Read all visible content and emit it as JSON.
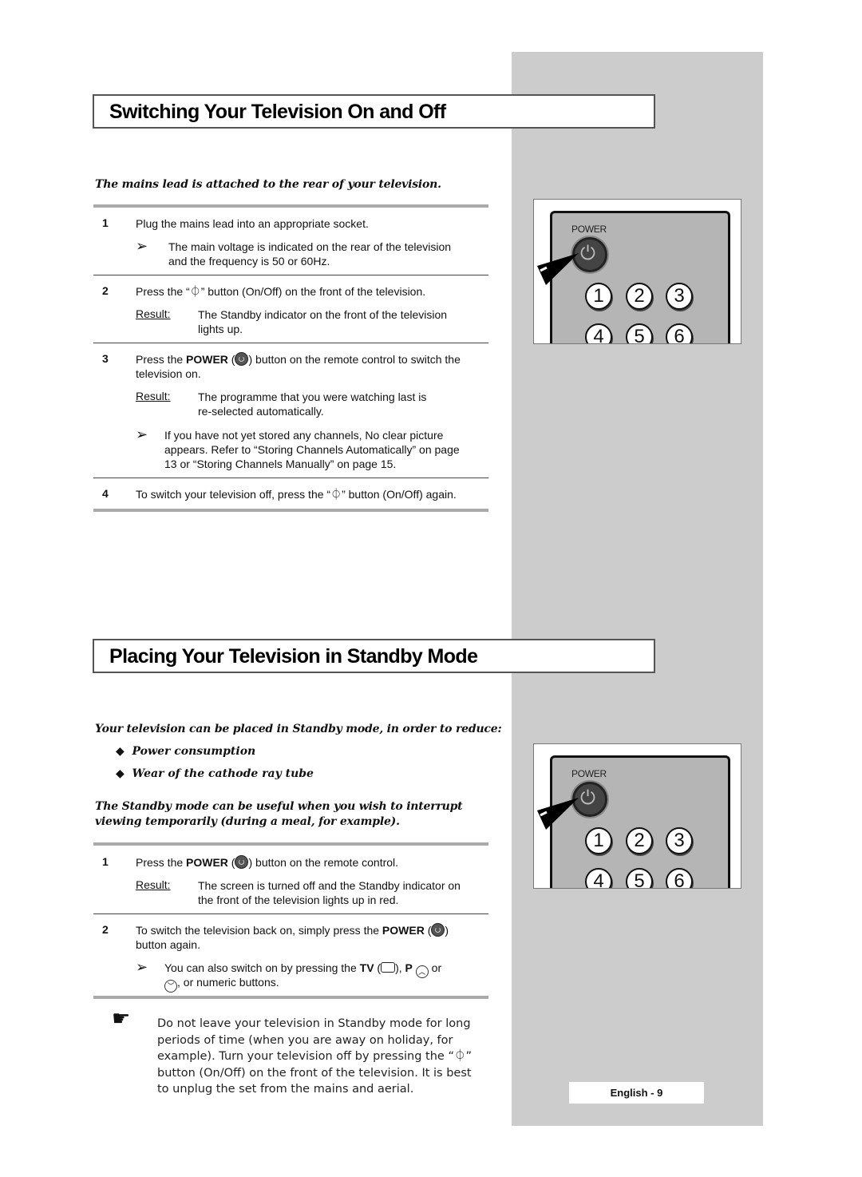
{
  "page": {
    "footer_label": "English - 9"
  },
  "section1": {
    "title": "Switching Your Television On and Off",
    "intro": "The mains lead is attached to the rear of your television.",
    "steps": [
      {
        "num": "1",
        "text": "Plug the mains lead into an appropriate socket.",
        "note": [
          "The main voltage is indicated on the rear of the television",
          "and the frequency is 50 or 60Hz."
        ]
      },
      {
        "num": "2",
        "text": "Press the “⏀” button (On/Off) on the front of the television.",
        "result_label": "Result:",
        "result": [
          "The Standby indicator on the front of the television",
          "lights up."
        ]
      },
      {
        "num": "3",
        "text_pre": "Press the ",
        "text_bold": "POWER",
        "text_post": ") button on the remote control to switch the",
        "text_line2": "television on.",
        "result_label": "Result:",
        "result": [
          "The programme that you were watching last is",
          "re-selected automatically."
        ],
        "note": [
          "If you have not yet stored any channels, No clear picture",
          "appears. Refer to “Storing Channels Automatically” on page",
          "13 or “Storing Channels Manually” on page 15."
        ]
      },
      {
        "num": "4",
        "text": "To switch your television off, press the “⏀” button (On/Off) again."
      }
    ]
  },
  "section2": {
    "title": "Placing Your Television in Standby Mode",
    "intro": "Your television can be placed in Standby mode, in order to reduce:",
    "bullets": [
      "Power consumption",
      "Wear of the cathode ray tube"
    ],
    "intro2": [
      "The Standby mode can be useful when you wish to interrupt",
      "viewing temporarily (during a meal, for example)."
    ],
    "steps": [
      {
        "num": "1",
        "text_pre": "Press the ",
        "text_bold": "POWER",
        "text_post": ") button on the remote control.",
        "result_label": "Result:",
        "result": [
          "The screen is turned off and the Standby indicator on",
          "the front of the television lights up in red."
        ]
      },
      {
        "num": "2",
        "text_pre": "To switch the television back on, simply press the ",
        "text_bold": "POWER",
        "text_post": ")",
        "text_line2": "button again.",
        "note_pre": "You can also switch on by pressing the ",
        "note_tv": "TV",
        "note_p": "P",
        "note_or": " or",
        "note_line2": ", or numeric buttons."
      }
    ],
    "warning": "Do not leave your television in Standby mode for long periods of time (when you are away on holiday, for example). Turn your television off by pressing the “⏀” button (On/Off) on the front of the television. It is best to unplug the set from the mains and aerial."
  },
  "remote": {
    "power_label": "POWER",
    "power_glyph": "⏻",
    "numbers": [
      "1",
      "2",
      "3",
      "4",
      "5",
      "6"
    ]
  },
  "icons": {
    "arrow": "➢",
    "bullet": "◆",
    "hand": "☛"
  }
}
